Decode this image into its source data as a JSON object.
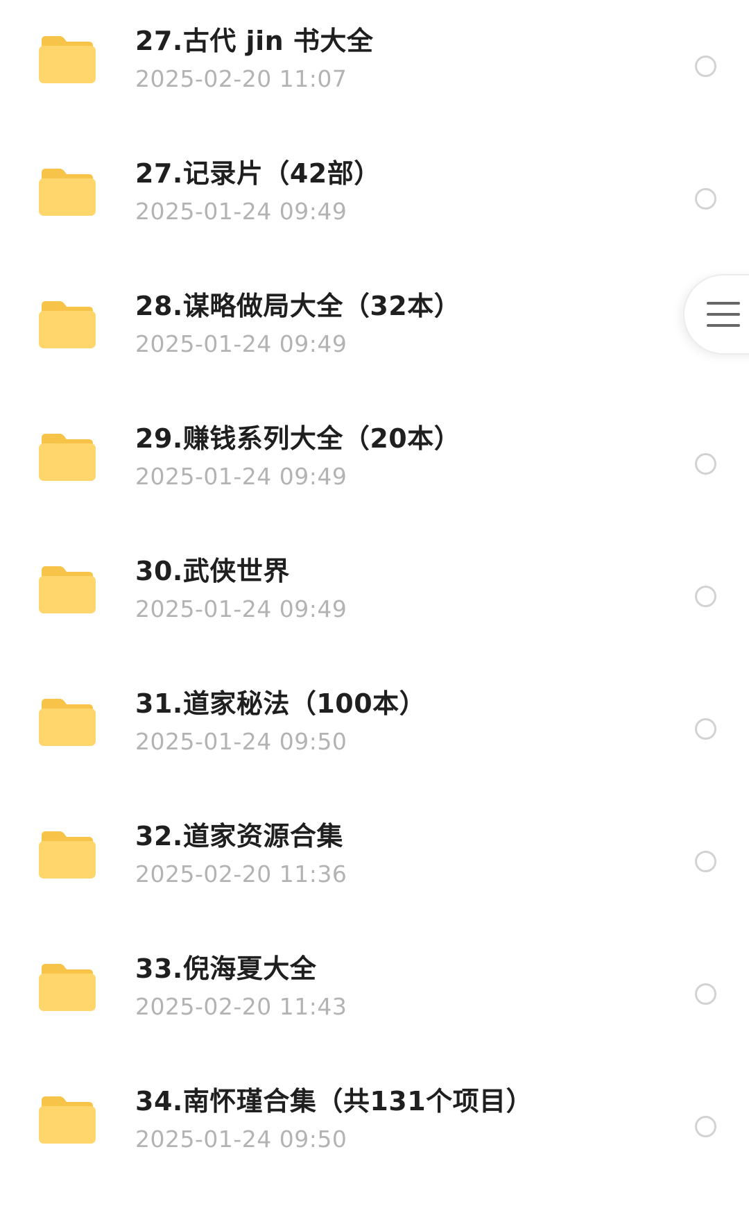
{
  "files": [
    {
      "name": "27.古代 jin 书大全",
      "date": "2025-02-20 11:07"
    },
    {
      "name": "27.记录片（42部）",
      "date": "2025-01-24 09:49"
    },
    {
      "name": "28.谋略做局大全（32本）",
      "date": "2025-01-24 09:49"
    },
    {
      "name": "29.赚钱系列大全（20本）",
      "date": "2025-01-24 09:49"
    },
    {
      "name": "30.武侠世界",
      "date": "2025-01-24 09:49"
    },
    {
      "name": "31.道家秘法（100本）",
      "date": "2025-01-24 09:50"
    },
    {
      "name": "32.道家资源合集",
      "date": "2025-02-20 11:36"
    },
    {
      "name": "33.倪海夏大全",
      "date": "2025-02-20 11:43"
    },
    {
      "name": "34.南怀瑾合集（共131个项目）",
      "date": "2025-01-24 09:50"
    }
  ],
  "icons": {
    "folder": "folder-icon",
    "select": "radio-circle-icon",
    "menu": "hamburger-menu-icon"
  },
  "colors": {
    "folder_body": "#FFD66B",
    "folder_tab": "#F7C348",
    "name_text": "#1F1F1F",
    "date_text": "#B3B3B3",
    "radio_border": "#D2D2D2"
  }
}
